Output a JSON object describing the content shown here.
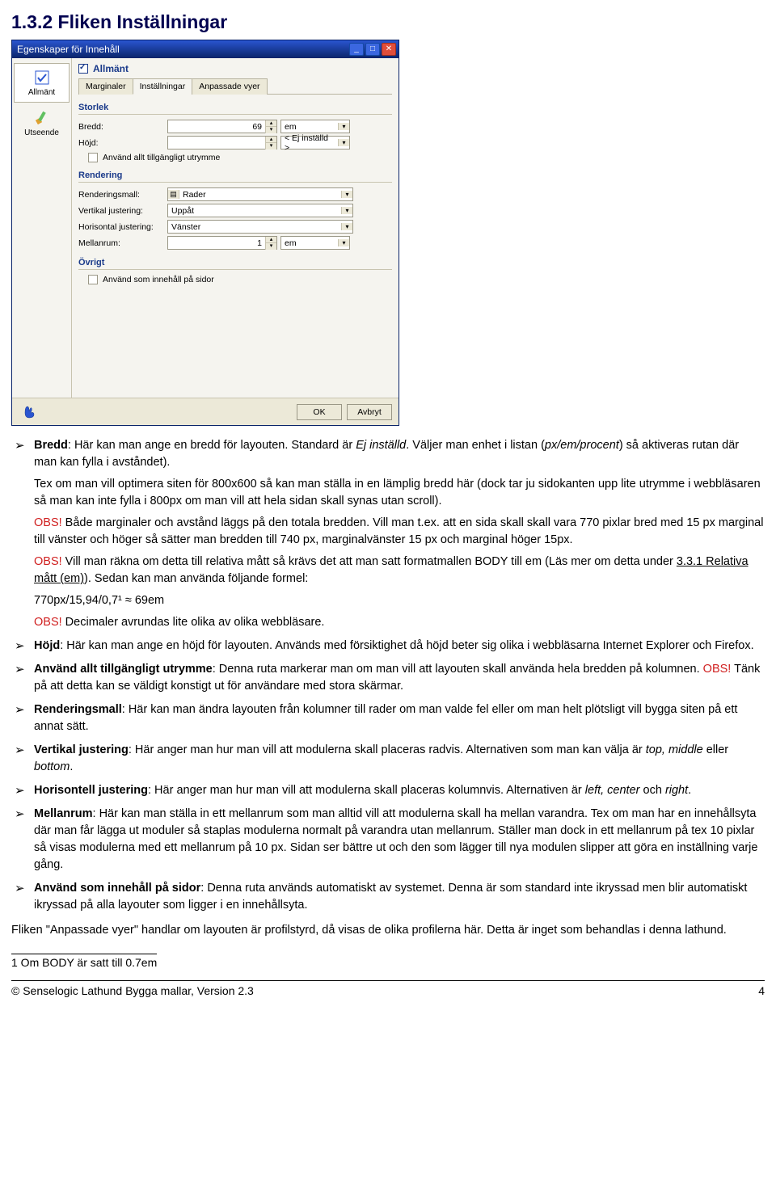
{
  "heading": "1.3.2 Fliken Inställningar",
  "window": {
    "title": "Egenskaper för Innehåll",
    "sidebar": [
      {
        "label": "Allmänt",
        "selected": true
      },
      {
        "label": "Utseende",
        "selected": false
      }
    ],
    "panel_title": "Allmänt",
    "tabs": [
      "Marginaler",
      "Inställningar",
      "Anpassade vyer"
    ],
    "active_tab_index": 1,
    "groups": {
      "storlek": {
        "title": "Storlek",
        "bredd_label": "Bredd:",
        "bredd_value": "69",
        "bredd_unit": "em",
        "hojd_label": "Höjd:",
        "hojd_value": "",
        "hojd_unit": "< Ej inställd >",
        "use_all_space": "Använd allt tillgängligt utrymme"
      },
      "rendering": {
        "title": "Rendering",
        "renderingsmall_label": "Renderingsmall:",
        "renderingsmall_value": "Rader",
        "vertikal_label": "Vertikal justering:",
        "vertikal_value": "Uppåt",
        "horisontal_label": "Horisontal justering:",
        "horisontal_value": "Vänster",
        "mellanrum_label": "Mellanrum:",
        "mellanrum_value": "1",
        "mellanrum_unit": "em"
      },
      "ovrigt": {
        "title": "Övrigt",
        "anvand_som": "Använd som innehåll på sidor"
      }
    },
    "buttons": {
      "ok": "OK",
      "cancel": "Avbryt"
    }
  },
  "bullets": {
    "bredd": {
      "lead": "Bredd",
      "t1": ": Här kan man ange en bredd för layouten. Standard är ",
      "ital1": "Ej inställd",
      "t2": ". Väljer man enhet i listan (",
      "ital2": "px/em/procent",
      "t3": ") så aktiveras rutan där man kan fylla i avståndet).",
      "p2": "Tex om man vill optimera siten för 800x600 så kan man ställa in en lämplig bredd här (dock tar ju sidokanten upp lite utrymme i webbläsaren så man kan inte fylla i 800px om man vill att hela sidan skall synas utan scroll).",
      "obs1_pre": "OBS!",
      "obs1_txt": " Både marginaler och avstånd läggs på den totala bredden. Vill man t.ex. att en sida skall skall vara 770 pixlar bred med 15 px marginal till vänster och höger så sätter man bredden till 740 px, marginalvänster 15 px och marginal höger 15px.",
      "obs2_pre": "OBS!",
      "obs2_txt_a": " Vill man räkna om detta till relativa mått så krävs det att man satt formatmallen BODY till em (Läs mer om detta under ",
      "obs2_link": "3.3.1 Relativa mått (em)",
      "obs2_txt_b": "). Sedan kan man använda följande formel:",
      "formula": "770px/15,94/0,7¹ ≈ 69em",
      "obs3_pre": "OBS!",
      "obs3_txt": " Decimaler avrundas lite olika av olika webbläsare."
    },
    "hojd": {
      "lead": "Höjd",
      "txt": ": Här kan man ange en höjd för layouten. Används med försiktighet då höjd beter sig olika i webbläsarna Internet Explorer och Firefox."
    },
    "allt": {
      "lead": "Använd allt tillgängligt utrymme",
      "txt_a": ": Denna ruta markerar man om man vill att layouten skall använda hela bredden på kolumnen.  ",
      "obs": "OBS!",
      "txt_b": " Tänk på att detta kan se väldigt konstigt ut för användare med stora skärmar."
    },
    "rendmall": {
      "lead": "Renderingsmall",
      "txt": ": Här kan man ändra layouten från kolumner till rader om man valde fel eller om man helt plötsligt vill bygga siten på ett annat sätt."
    },
    "vert": {
      "lead": "Vertikal justering",
      "txt_a": ":  Här anger man hur man vill att modulerna skall placeras radvis. Alternativen som man kan välja är ",
      "ital": "top, middle ",
      "txt_b": "eller ",
      "ital2": "bottom",
      "txt_c": "."
    },
    "horis": {
      "lead": "Horisontell justering",
      "txt_a": ": Här anger man hur man vill att modulerna skall placeras kolumnvis. Alternativen är ",
      "ital": "left, center ",
      "txt_b": "och ",
      "ital2": "right",
      "txt_c": "."
    },
    "mellan": {
      "lead": "Mellanrum",
      "txt": ": Här kan man ställa in ett mellanrum som man alltid vill att modulerna skall ha mellan varandra. Tex om man har en innehållsyta där man får lägga ut moduler så staplas modulerna normalt på varandra utan mellanrum. Ställer man dock in ett mellanrum på tex 10 pixlar så visas modulerna med ett mellanrum på 10 px. Sidan ser bättre ut och den som lägger till nya modulen slipper att göra en inställning varje gång."
    },
    "anvsom": {
      "lead": "Använd som innehåll på sidor",
      "txt": ": Denna ruta används automatiskt av systemet. Denna är som standard inte ikryssad men blir automatiskt ikryssad på alla layouter som ligger i en innehållsyta."
    }
  },
  "final_para": "Fliken \"Anpassade vyer\" handlar om layouten är profilstyrd, då visas de olika profilerna här. Detta är inget som behandlas i denna lathund.",
  "footnote": "1  Om BODY är satt till 0.7em",
  "pagefoot": {
    "left": "© Senselogic Lathund Bygga mallar, Version 2.3",
    "right": "4"
  }
}
